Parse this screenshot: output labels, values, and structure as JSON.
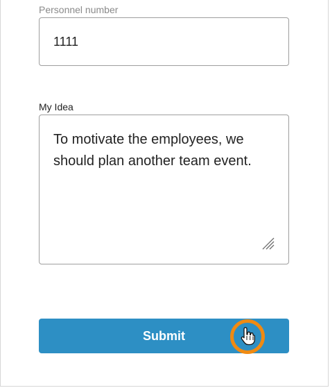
{
  "form": {
    "personnel_number": {
      "label": "Personnel number",
      "value": "1111"
    },
    "idea": {
      "label": "My Idea",
      "value": "To motivate the employees, we\nshould plan another team event."
    },
    "submit_label": "Submit"
  },
  "icons": {
    "resize": "resize-handle-icon",
    "cursor": "hand-pointer-cursor-icon"
  },
  "colors": {
    "accent": "#2d8fc4",
    "cursor_highlight": "#f08a12",
    "border": "#9e9e9e"
  }
}
